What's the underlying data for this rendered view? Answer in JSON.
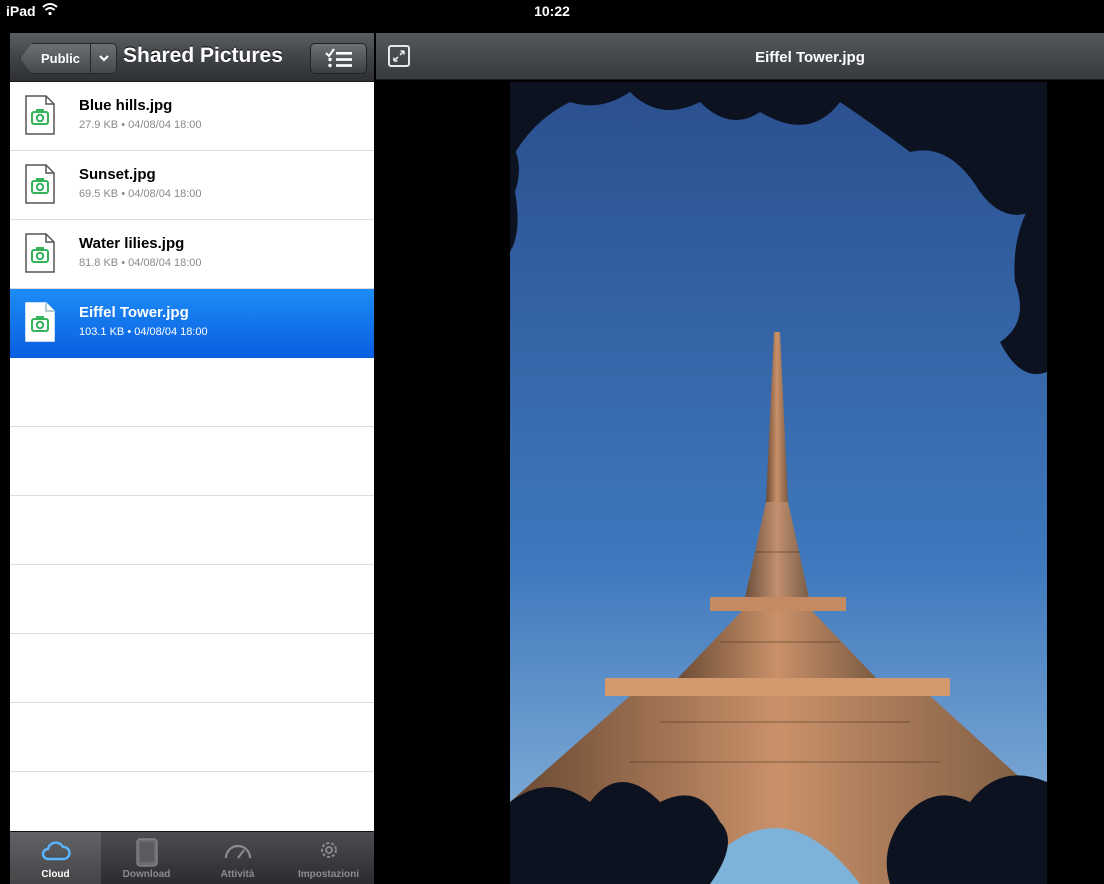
{
  "status_bar": {
    "device": "iPad",
    "time": "10:22"
  },
  "left_panel": {
    "back_button": "Public",
    "title": "Shared Pictures",
    "files": [
      {
        "name": "Blue hills.jpg",
        "size": "27.9 KB",
        "date": "04/08/04 18:00"
      },
      {
        "name": "Sunset.jpg",
        "size": "69.5 KB",
        "date": "04/08/04 18:00"
      },
      {
        "name": "Water lilies.jpg",
        "size": "81.8 KB",
        "date": "04/08/04 18:00"
      },
      {
        "name": "Eiffel Tower.jpg",
        "size": "103.1 KB",
        "date": "04/08/04 18:00"
      }
    ],
    "meta_separator": "•"
  },
  "tabbar": {
    "tabs": [
      {
        "label": "Cloud",
        "icon": "cloud-icon",
        "active": true
      },
      {
        "label": "Download",
        "icon": "tablet-icon",
        "active": false
      },
      {
        "label": "Attività",
        "icon": "speedometer-icon",
        "active": false
      },
      {
        "label": "Impostazioni",
        "icon": "gear-icon",
        "active": false
      }
    ]
  },
  "viewer": {
    "title": "Eiffel Tower.jpg"
  },
  "colors": {
    "selection": "#1473e6",
    "file_icon_accent": "#35b35b"
  }
}
